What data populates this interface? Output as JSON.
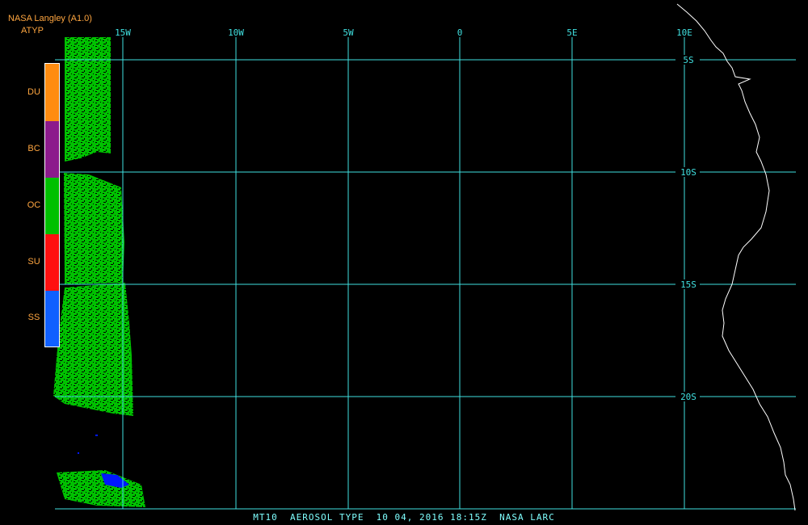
{
  "header": {
    "source": "NASA Langley (A1.0)",
    "product": "ATYP"
  },
  "legend": [
    {
      "code": "DU",
      "color": "#ff8c10"
    },
    {
      "code": "BC",
      "color": "#8c1a8c"
    },
    {
      "code": "OC",
      "color": "#00c000"
    },
    {
      "code": "SU",
      "color": "#ff1010"
    },
    {
      "code": "SS",
      "color": "#1060ff"
    }
  ],
  "grid": {
    "longitude_labels": [
      "15W",
      "10W",
      "5W",
      "0",
      "5E",
      "10E"
    ],
    "latitude_labels": [
      "5S",
      "10S",
      "15S",
      "20S"
    ],
    "color": "#40e0e0"
  },
  "coastline_color": "#ffffff",
  "caption": "MT10  AEROSOL TYPE  10 04, 2016 18:15Z  NASA LARC"
}
